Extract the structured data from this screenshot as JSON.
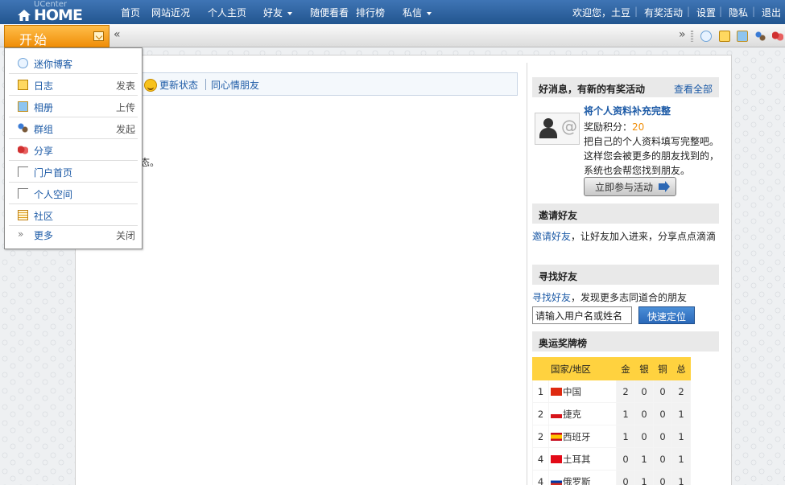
{
  "logo": {
    "top": "UCenter",
    "main": "HOME"
  },
  "nav": [
    {
      "label": "首页"
    },
    {
      "label": "网站近况"
    },
    {
      "label": "个人主页"
    },
    {
      "label": "好友",
      "dropdown": true
    },
    {
      "label": "随便看看"
    },
    {
      "label": "排行榜"
    },
    {
      "label": "私信",
      "dropdown": true
    }
  ],
  "right_nav": {
    "welcome": "欢迎您，土豆",
    "items": [
      "有奖活动",
      "设置",
      "隐私",
      "退出"
    ]
  },
  "start": {
    "label": "开始"
  },
  "start_menu": [
    {
      "label": "迷你博客",
      "icon": "chat-bubble-icon"
    },
    {
      "label": "日志",
      "action": "发表",
      "icon": "notepad-icon"
    },
    {
      "label": "相册",
      "action": "上传",
      "icon": "photo-icon"
    },
    {
      "label": "群组",
      "action": "发起",
      "icon": "group-icon"
    },
    {
      "label": "分享",
      "icon": "hearts-icon"
    },
    {
      "label": "门户首页",
      "icon": "page-icon"
    },
    {
      "label": "个人空间",
      "icon": "page-icon"
    },
    {
      "label": "社区",
      "icon": "forum-icon"
    },
    {
      "label": "更多",
      "action": "关闭",
      "icon": "double-chevron-icon"
    }
  ],
  "status_bar": {
    "update": "更新状态",
    "friends": "同心情朋友"
  },
  "fragment": "态。",
  "sidebar": {
    "promo": {
      "heading": "好消息，有新的有奖活动",
      "more": "查看全部",
      "title": "将个人资料补充完整",
      "points_label": "奖励积分：",
      "points": "20",
      "lines": [
        "把自己的个人资料填写完整吧。",
        "这样您会被更多的朋友找到的，",
        "系统也会帮您找到朋友。"
      ],
      "button": "立即参与活动"
    },
    "invite": {
      "heading": "邀请好友",
      "link": "邀请好友",
      "text": "，让好友加入进来，分享点点滴滴"
    },
    "find": {
      "heading": "寻找好友",
      "link": "寻找好友",
      "text": "，发现更多志同道合的朋友",
      "input": "请输入用户名或姓名",
      "button": "快速定位"
    },
    "medals": {
      "heading": "奥运奖牌榜",
      "cols": [
        "国家/地区",
        "金",
        "银",
        "铜",
        "总"
      ],
      "rows": [
        [
          "1",
          "中国",
          "2",
          "0",
          "0",
          "2"
        ],
        [
          "2",
          "捷克",
          "1",
          "0",
          "0",
          "1"
        ],
        [
          "2",
          "西班牙",
          "1",
          "0",
          "0",
          "1"
        ],
        [
          "4",
          "土耳其",
          "0",
          "1",
          "0",
          "1"
        ],
        [
          "4",
          "俄罗斯",
          "0",
          "1",
          "0",
          "1"
        ]
      ]
    }
  },
  "colors": {
    "topbar": "#2f66a6",
    "start": "#f5a021",
    "link": "#1c5aa6",
    "medal_header": "#ffd23f"
  }
}
